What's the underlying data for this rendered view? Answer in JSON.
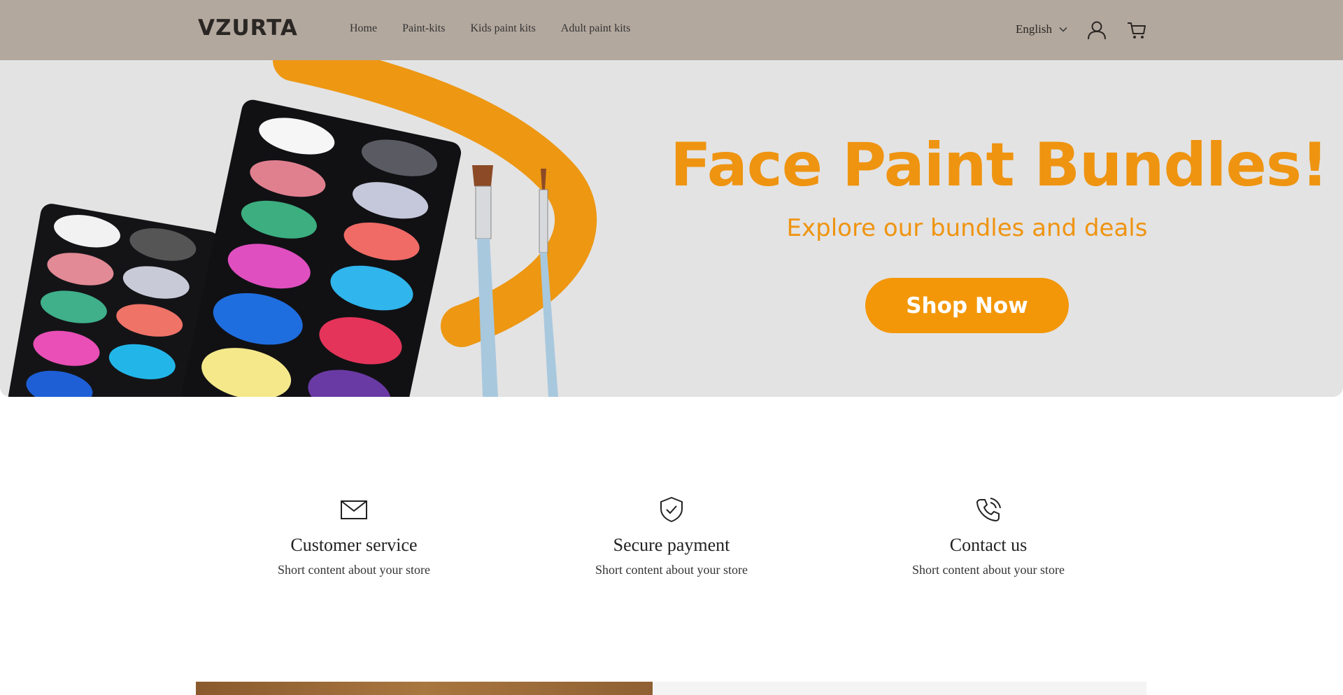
{
  "header": {
    "logo": "VZURTA",
    "nav": [
      "Home",
      "Paint-kits",
      "Kids paint kits",
      "Adult paint kits"
    ],
    "language": "English",
    "icons": {
      "account": "account-icon",
      "cart": "cart-icon",
      "chevron": "chevron-down-icon"
    },
    "bg_color": "#b3a89e"
  },
  "hero": {
    "title": "Face Paint Bundles!",
    "subtitle": "Explore our bundles and deals",
    "button_label": "Shop Now",
    "accent_color": "#ef9410"
  },
  "features": [
    {
      "icon": "mail-icon",
      "title": "Customer service",
      "text": "Short content about your store"
    },
    {
      "icon": "shield-check-icon",
      "title": "Secure payment",
      "text": "Short content about your store"
    },
    {
      "icon": "phone-icon",
      "title": "Contact us",
      "text": "Short content about your store"
    }
  ]
}
